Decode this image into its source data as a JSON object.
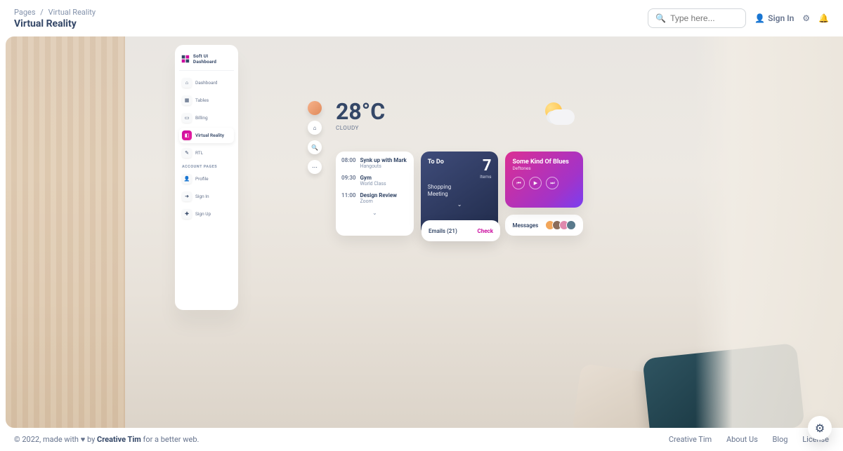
{
  "breadcrumb": {
    "root": "Pages",
    "current": "Virtual Reality"
  },
  "page_title": "Virtual Reality",
  "search": {
    "placeholder": "Type here..."
  },
  "signin_label": "Sign In",
  "sidebar": {
    "brand": "Soft UI Dashboard",
    "items": [
      {
        "label": "Dashboard",
        "glyph": "⌂"
      },
      {
        "label": "Tables",
        "glyph": "▦"
      },
      {
        "label": "Billing",
        "glyph": "▭"
      },
      {
        "label": "Virtual Reality",
        "glyph": "◧"
      },
      {
        "label": "RTL",
        "glyph": "✎"
      }
    ],
    "section_label": "ACCOUNT PAGES",
    "account_items": [
      {
        "label": "Profile",
        "glyph": "👤"
      },
      {
        "label": "Sign In",
        "glyph": "➜"
      },
      {
        "label": "Sign Up",
        "glyph": "✚"
      }
    ]
  },
  "circle_button_glyphs": {
    "home": "⌂",
    "search": "🔍",
    "more": "⋯"
  },
  "weather": {
    "temp": "28°C",
    "condition": "CLOUDY"
  },
  "schedule": [
    {
      "time": "08:00",
      "title": "Synk up with Mark",
      "sub": "Hangouts"
    },
    {
      "time": "09:30",
      "title": "Gym",
      "sub": "World Class"
    },
    {
      "time": "11:00",
      "title": "Design Review",
      "sub": "Zoom"
    }
  ],
  "todo": {
    "title": "To Do",
    "count": "7",
    "items_label": "Items",
    "task": "Shopping\nMeeting"
  },
  "music": {
    "song": "Some Kind Of Blues",
    "artist": "Deftones",
    "glyphs": {
      "prev": "⏮",
      "play": "▶",
      "next": "⏭"
    }
  },
  "emails": {
    "label": "Emails (21)",
    "action": "Check"
  },
  "messages": {
    "label": "Messages"
  },
  "footer": {
    "copyright_prefix": "© 2022, made with ",
    "heart": "♥",
    "by": " by ",
    "brand": "Creative Tim",
    "suffix": " for a better web.",
    "links": [
      "Creative Tim",
      "About Us",
      "Blog",
      "License"
    ]
  },
  "expand_glyph": "⌄",
  "settings_glyph": "⚙"
}
